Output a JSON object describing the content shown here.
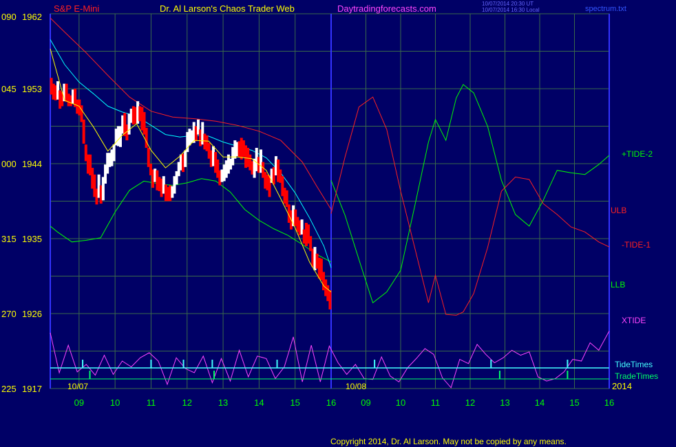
{
  "header": {
    "instrument": "S&P E-Mini",
    "site_title": "Dr. Al Larson's Chaos Trader Web",
    "site_url": "Daytradingforecasts.com",
    "timestamp_1": "10/07/2014 20:30 UT",
    "timestamp_2": "10/07/2014 16:30 Local",
    "filename": "spectrum.txt"
  },
  "footer": {
    "copyright": "Copyright 2014, Dr. Al Larson. May not be copied by any means."
  },
  "colors": {
    "background": "#000066",
    "plot_bg": "#000066",
    "grid": "#3a6a4a",
    "vline": "#3333ff",
    "price_down": "#ff0000",
    "price_up": "#ffffff",
    "ulb": "#ff2020",
    "llb": "#00ff00",
    "tide2": "#00ff00",
    "tide1": "#ff2020",
    "xtide": "#ff44ff",
    "ma_fast": "#ffff00",
    "ma_slow": "#00ffff",
    "tide_times": "#44ffff",
    "trade_times": "#00ff66",
    "axis_text": "#ffff00",
    "hour_text": "#00ff00",
    "title_text": "#ffff00",
    "url_text": "#ff44ff"
  },
  "chart_data": {
    "type": "line",
    "title": "S&P E-Mini",
    "y_ticks": [
      {
        "left": "090",
        "price": "1962"
      },
      {
        "left": "045",
        "price": "1953"
      },
      {
        "left": "000",
        "price": "1944"
      },
      {
        "left": "315",
        "price": "1935"
      },
      {
        "left": "270",
        "price": "1926"
      },
      {
        "left": "225",
        "price": "1917"
      }
    ],
    "ylim": [
      1917,
      1962
    ],
    "xlim": [
      8.2,
      16
    ],
    "x_tick_labels": [
      "09",
      "10",
      "11",
      "12",
      "13",
      "14",
      "15",
      "16",
      "09",
      "10",
      "11",
      "12",
      "13",
      "14",
      "15",
      "16"
    ],
    "date_labels": [
      "10/07",
      "10/08",
      "2014"
    ],
    "session_divider_x": 16,
    "series_labels": [
      "+TIDE-2",
      "ULB",
      "-TIDE-1",
      "LLB",
      "XTIDE",
      "TideTimes",
      "TradeTimes"
    ],
    "ulb": {
      "x": [
        8.2,
        8.6,
        9.2,
        9.8,
        10.4,
        11.0,
        11.6,
        12.2,
        12.8,
        13.4,
        14.0,
        14.6,
        15.2,
        15.6,
        16.0
      ],
      "y": [
        1961.5,
        1959.8,
        1957.3,
        1954.6,
        1952.0,
        1950.3,
        1949.6,
        1949.4,
        1949.1,
        1948.6,
        1947.9,
        1946.8,
        1944.2,
        1941.3,
        1938.5
      ]
    },
    "llb": {
      "x": [
        8.2,
        8.4,
        8.8,
        9.2,
        9.6,
        10.0,
        10.4,
        10.8,
        11.2,
        11.6,
        12.0,
        12.4,
        12.8,
        13.2,
        13.6,
        14.0,
        14.4,
        14.8,
        15.2,
        15.6,
        16.0
      ],
      "y": [
        1936.5,
        1935.8,
        1934.6,
        1934.8,
        1935.1,
        1938.2,
        1940.8,
        1941.9,
        1941.6,
        1941.4,
        1941.7,
        1942.2,
        1941.9,
        1940.6,
        1938.5,
        1937.2,
        1936.2,
        1935.4,
        1934.3,
        1933.1,
        1932.2
      ]
    },
    "ma_fast": {
      "x": [
        8.2,
        8.6,
        9.0,
        9.4,
        9.8,
        10.2,
        10.6,
        11.0,
        11.4,
        11.8,
        12.2,
        12.6,
        13.0,
        13.4,
        13.8,
        14.2,
        14.6,
        15.0,
        15.4,
        15.8,
        16.0
      ],
      "y": [
        1957.8,
        1951.6,
        1950.9,
        1948.4,
        1945.5,
        1947.4,
        1948.8,
        1945.6,
        1943.5,
        1944.9,
        1946.8,
        1946.7,
        1944.8,
        1944.8,
        1944.6,
        1943.2,
        1939.8,
        1936.3,
        1932.2,
        1929.3,
        1928.6
      ]
    },
    "ma_slow": {
      "x": [
        8.2,
        8.6,
        9.0,
        9.4,
        9.8,
        10.2,
        10.6,
        11.0,
        11.4,
        11.8,
        12.2,
        12.6,
        13.0,
        13.4,
        13.8,
        14.2,
        14.6,
        15.0,
        15.4,
        15.8,
        16.0
      ],
      "y": [
        1958.9,
        1955.9,
        1953.8,
        1952.4,
        1950.9,
        1950.2,
        1949.7,
        1948.6,
        1947.5,
        1947.2,
        1947.4,
        1947.3,
        1946.6,
        1946.1,
        1945.6,
        1944.7,
        1942.9,
        1940.5,
        1937.5,
        1934.1,
        1931.5
      ]
    },
    "tide2": {
      "x": [
        16.0,
        16.4,
        16.8,
        17.2,
        17.6,
        18.0,
        18.4,
        18.8,
        19.0,
        19.3,
        19.6,
        19.8,
        20.1,
        20.5,
        20.9,
        21.3,
        21.7,
        22.1,
        22.5,
        22.9,
        23.3,
        23.7,
        24.0
      ],
      "y": [
        1942.0,
        1937.8,
        1932.5,
        1927.3,
        1928.6,
        1931.2,
        1938.8,
        1946.6,
        1949.3,
        1946.8,
        1951.9,
        1953.5,
        1952.5,
        1948.5,
        1942.0,
        1937.9,
        1936.5,
        1939.6,
        1943.2,
        1942.9,
        1942.7,
        1943.9,
        1945.0
      ]
    },
    "tide1": {
      "x": [
        16.0,
        16.4,
        16.8,
        17.2,
        17.6,
        18.0,
        18.4,
        18.8,
        19.0,
        19.3,
        19.6,
        19.8,
        20.1,
        20.5,
        20.9,
        21.3,
        21.7,
        22.1,
        22.5,
        22.9,
        23.3,
        23.7,
        24.0
      ],
      "y": [
        1938.0,
        1944.8,
        1950.8,
        1952.0,
        1948.1,
        1940.7,
        1934.0,
        1927.3,
        1930.6,
        1925.9,
        1925.8,
        1926.2,
        1928.4,
        1933.9,
        1940.7,
        1942.4,
        1942.1,
        1939.2,
        1937.9,
        1936.4,
        1935.8,
        1934.6,
        1934.0
      ]
    },
    "xtide": {
      "x": [
        8.2,
        8.45,
        8.7,
        8.95,
        9.2,
        9.45,
        9.7,
        9.95,
        10.2,
        10.45,
        10.7,
        10.95,
        11.2,
        11.45,
        11.7,
        11.95,
        12.2,
        12.45,
        12.7,
        12.95,
        13.2,
        13.45,
        13.7,
        13.95,
        14.2,
        14.45,
        14.7,
        14.95,
        15.2,
        15.45,
        15.7,
        15.95,
        16.2,
        16.45,
        16.7,
        16.95,
        17.2,
        17.45,
        17.7,
        17.95,
        18.2,
        18.45,
        18.7,
        18.95,
        19.2,
        19.45,
        19.7,
        19.95,
        20.2,
        20.45,
        20.7,
        20.95,
        21.2,
        21.45,
        21.7,
        21.95,
        22.2,
        22.45,
        22.7,
        22.95,
        23.2,
        23.45,
        23.7,
        24.0
      ],
      "y": [
        1923.7,
        1918.9,
        1922.2,
        1919.0,
        1919.9,
        1918.6,
        1921.0,
        1918.7,
        1920.3,
        1919.6,
        1920.7,
        1921.3,
        1920.3,
        1917.5,
        1920.7,
        1919.4,
        1918.9,
        1920.9,
        1917.7,
        1920.6,
        1917.9,
        1921.6,
        1918.4,
        1920.9,
        1920.6,
        1918.2,
        1919.6,
        1923.2,
        1917.8,
        1922.2,
        1917.8,
        1922.1,
        1920.1,
        1918.7,
        1919.9,
        1918.2,
        1918.1,
        1920.8,
        1918.5,
        1917.8,
        1919.5,
        1920.6,
        1921.8,
        1921.1,
        1918.3,
        1917.1,
        1920.5,
        1920.0,
        1922.3,
        1921.1,
        1920.1,
        1920.7,
        1921.6,
        1921.0,
        1921.4,
        1918.4,
        1917.9,
        1918.2,
        1919.0,
        1920.5,
        1920.3,
        1922.5,
        1921.6,
        1923.9
      ]
    },
    "price_bars": {
      "x": [
        8.23,
        8.29,
        8.35,
        8.41,
        8.47,
        8.53,
        8.59,
        8.65,
        8.71,
        8.77,
        8.83,
        8.89,
        8.95,
        9.01,
        9.07,
        9.13,
        9.19,
        9.25,
        9.31,
        9.37,
        9.43,
        9.49,
        9.55,
        9.61,
        9.67,
        9.73,
        9.79,
        9.85,
        9.91,
        9.97,
        10.03,
        10.09,
        10.15,
        10.21,
        10.27,
        10.33,
        10.39,
        10.45,
        10.51,
        10.57,
        10.63,
        10.69,
        10.75,
        10.81,
        10.87,
        10.93,
        10.99,
        11.05,
        11.11,
        11.17,
        11.23,
        11.29,
        11.35,
        11.41,
        11.47,
        11.53,
        11.59,
        11.65,
        11.71,
        11.77,
        11.83,
        11.89,
        11.95,
        12.01,
        12.07,
        12.13,
        12.19,
        12.25,
        12.31,
        12.37,
        12.43,
        12.49,
        12.55,
        12.61,
        12.67,
        12.73,
        12.79,
        12.85,
        12.91,
        12.97,
        13.03,
        13.09,
        13.15,
        13.21,
        13.27,
        13.33,
        13.39,
        13.45,
        13.51,
        13.57,
        13.63,
        13.69,
        13.75,
        13.81,
        13.87,
        13.93,
        13.99,
        14.05,
        14.11,
        14.17,
        14.23,
        14.29,
        14.35,
        14.41,
        14.47,
        14.53,
        14.59,
        14.65,
        14.71,
        14.77,
        14.83,
        14.89,
        14.95,
        15.01,
        15.07,
        15.13,
        15.19,
        15.25,
        15.31,
        15.37,
        15.43,
        15.49,
        15.55,
        15.61,
        15.67,
        15.73,
        15.79,
        15.85,
        15.91,
        15.97
      ],
      "high": [
        1954.3,
        1953.6,
        1953.4,
        1953.9,
        1952.8,
        1952.6,
        1953.6,
        1953.6,
        1952.4,
        1952.2,
        1952.9,
        1953.0,
        1951.7,
        1951.7,
        1951.0,
        1949.3,
        1946.3,
        1945.1,
        1945.1,
        1943.5,
        1942.7,
        1941.0,
        1942.7,
        1941.4,
        1942.4,
        1943.9,
        1945.3,
        1945.3,
        1945.7,
        1946.3,
        1948.2,
        1948.5,
        1948.5,
        1949.8,
        1950.1,
        1948.7,
        1950.0,
        1950.6,
        1950.9,
        1950.8,
        1951.5,
        1950.9,
        1950.8,
        1950.2,
        1948.3,
        1945.9,
        1944.0,
        1943.3,
        1943.4,
        1943.2,
        1942.4,
        1942.2,
        1942.5,
        1941.5,
        1941.2,
        1941.4,
        1941.3,
        1942.5,
        1943.1,
        1944.2,
        1945.1,
        1945.2,
        1945.6,
        1947.8,
        1948.2,
        1948.0,
        1949.0,
        1948.5,
        1949.3,
        1948.1,
        1949.0,
        1947.6,
        1947.4,
        1946.5,
        1945.6,
        1946.1,
        1945.4,
        1944.5,
        1943.2,
        1943.3,
        1943.9,
        1944.4,
        1945.1,
        1944.6,
        1946.0,
        1946.8,
        1946.6,
        1946.7,
        1947.1,
        1946.8,
        1946.2,
        1945.9,
        1945.1,
        1944.3,
        1944.6,
        1945.9,
        1944.8,
        1945.7,
        1944.2,
        1943.0,
        1942.7,
        1942.6,
        1943.4,
        1943.6,
        1944.9,
        1944.5,
        1943.3,
        1942.5,
        1941.1,
        1940.8,
        1939.1,
        1938.4,
        1939.0,
        1938.5,
        1937.6,
        1937.2,
        1937.3,
        1936.1,
        1936.9,
        1936.7,
        1935.3,
        1933.8,
        1934.0,
        1933.2,
        1932.7,
        1932.6,
        1931.0,
        1930.1,
        1929.4,
        1928.8
      ],
      "low": [
        1952.3,
        1951.7,
        1951.6,
        1951.7,
        1950.6,
        1950.9,
        1951.5,
        1951.4,
        1950.9,
        1950.9,
        1951.2,
        1950.8,
        1950.0,
        1949.8,
        1949.0,
        1946.4,
        1944.3,
        1942.8,
        1942.6,
        1941.0,
        1940.0,
        1939.1,
        1939.9,
        1939.2,
        1939.6,
        1941.6,
        1942.8,
        1943.6,
        1943.7,
        1944.3,
        1946.2,
        1946.1,
        1946.0,
        1947.6,
        1947.3,
        1946.8,
        1947.5,
        1948.9,
        1948.7,
        1948.8,
        1948.8,
        1949.1,
        1948.0,
        1947.5,
        1945.9,
        1943.6,
        1942.6,
        1941.1,
        1941.8,
        1940.8,
        1940.7,
        1940.0,
        1940.4,
        1939.5,
        1939.5,
        1939.5,
        1939.9,
        1940.4,
        1941.5,
        1942.5,
        1943.2,
        1943.0,
        1943.6,
        1945.4,
        1946.2,
        1946.5,
        1946.5,
        1946.7,
        1947.5,
        1946.1,
        1946.3,
        1945.7,
        1945.5,
        1944.6,
        1943.6,
        1943.7,
        1942.9,
        1942.3,
        1941.4,
        1941.8,
        1941.9,
        1942.3,
        1942.8,
        1943.3,
        1943.8,
        1944.6,
        1944.9,
        1944.8,
        1944.5,
        1944.8,
        1943.5,
        1943.6,
        1943.2,
        1942.7,
        1942.3,
        1943.1,
        1942.9,
        1942.9,
        1942.3,
        1941.0,
        1940.8,
        1940.0,
        1941.7,
        1941.5,
        1942.6,
        1941.8,
        1941.7,
        1940.1,
        1939.2,
        1938.8,
        1936.9,
        1936.1,
        1936.5,
        1936.5,
        1935.8,
        1935.4,
        1935.5,
        1934.4,
        1934.1,
        1934.4,
        1933.5,
        1931.6,
        1931.2,
        1931.4,
        1930.2,
        1930.0,
        1928.8,
        1928.1,
        1927.5,
        1926.5
      ],
      "up": [
        false,
        false,
        false,
        true,
        false,
        false,
        true,
        false,
        false,
        false,
        true,
        false,
        false,
        false,
        false,
        false,
        false,
        false,
        false,
        false,
        false,
        false,
        true,
        false,
        true,
        true,
        true,
        true,
        true,
        true,
        true,
        true,
        true,
        true,
        false,
        false,
        true,
        true,
        false,
        false,
        true,
        false,
        false,
        false,
        false,
        false,
        false,
        false,
        true,
        false,
        false,
        false,
        true,
        false,
        false,
        false,
        true,
        true,
        true,
        true,
        true,
        false,
        true,
        true,
        true,
        true,
        true,
        false,
        true,
        false,
        true,
        false,
        false,
        false,
        false,
        true,
        false,
        false,
        false,
        true,
        true,
        true,
        true,
        true,
        true,
        true,
        true,
        false,
        false,
        false,
        false,
        false,
        false,
        false,
        true,
        true,
        false,
        true,
        false,
        false,
        false,
        false,
        true,
        false,
        true,
        false,
        false,
        false,
        false,
        false,
        false,
        false,
        true,
        false,
        false,
        false,
        true,
        false,
        false,
        false,
        false,
        false,
        true,
        false,
        false,
        false,
        false,
        false,
        false,
        false
      ]
    },
    "tide_times": [
      9.1,
      11.0,
      11.9,
      12.7,
      14.5,
      17.25,
      20.6,
      22.8
    ],
    "trade_times": [
      9.3,
      12.75,
      20.85,
      22.8
    ]
  }
}
